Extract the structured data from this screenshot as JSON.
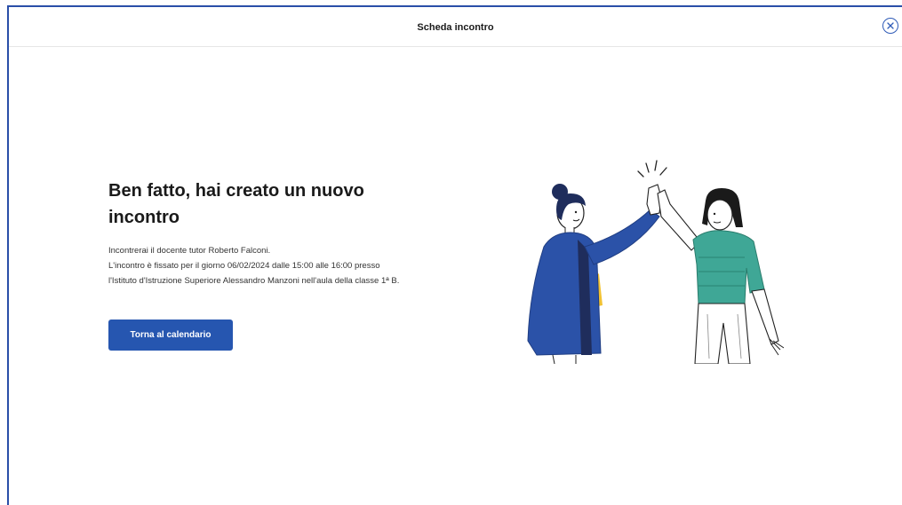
{
  "header": {
    "title": "Scheda incontro",
    "close_icon": "close-icon"
  },
  "main": {
    "heading_line1": "Ben fatto, hai creato un nuovo",
    "heading_line2": "incontro",
    "description": [
      "Incontrerai il docente tutor Roberto Falconi.",
      "L'incontro è fissato per il giorno 06/02/2024 dalle 15:00 alle 16:00 presso",
      "l'Istituto d'Istruzione Superiore Alessandro Manzoni nell'aula della classe 1ª B."
    ],
    "cta_label": "Torna al calendario",
    "illustration": "high-five-illustration"
  },
  "colors": {
    "accent": "#2656b0",
    "frame_border": "#2a4fa8",
    "figure_left_coat": "#2b52a8",
    "figure_right_shirt": "#3fa796"
  }
}
